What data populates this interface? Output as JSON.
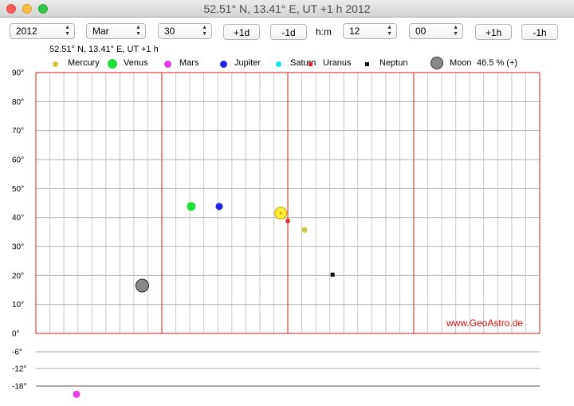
{
  "window": {
    "title": "52.51° N,  13.41° E,  UT +1 h 2012"
  },
  "controls": {
    "year": "2012",
    "month": "Mar",
    "day": "30",
    "plus_day": "+1d",
    "minus_day": "-1d",
    "hm_label": "h:m",
    "hour": "12",
    "minute": "00",
    "plus_hour": "+1h",
    "minus_hour": "-1h"
  },
  "location_label": "52.51° N,  13.41° E,  UT +1 h",
  "legend": [
    {
      "name": "Mercury",
      "color": "#cfc33a"
    },
    {
      "name": "Venus",
      "color": "#1ee036"
    },
    {
      "name": "Mars",
      "color": "#f03ce6"
    },
    {
      "name": "Jupiter",
      "color": "#2323e6"
    },
    {
      "name": "Saturn",
      "color": "#12e8e8"
    },
    {
      "name": "Uranus",
      "color": "#e02323"
    },
    {
      "name": "Neptun",
      "color": "#111111"
    },
    {
      "name": "Moon",
      "color": "#888888",
      "extra": "46.5 % (+)"
    }
  ],
  "credit": "www.GeoAstro.de",
  "chart_data": {
    "type": "scatter",
    "y_axis_unit": "altitude (degrees)",
    "ylim": [
      -18,
      90
    ],
    "y_ticks": [
      "90°",
      "80°",
      "70°",
      "60°",
      "50°",
      "40°",
      "30°",
      "20°",
      "10°",
      "0°",
      "-6°",
      "-12°",
      "-18°"
    ],
    "y_tick_values": [
      90,
      80,
      70,
      60,
      50,
      40,
      30,
      20,
      10,
      0,
      -6,
      -12,
      -18
    ],
    "azimuth_range": [
      0,
      360
    ],
    "major_verticals_azimuth": [
      90,
      180,
      270
    ],
    "points": [
      {
        "name": "Mercury",
        "x": 192,
        "y": 35.7,
        "color": "#cfc33a",
        "r": 3.5
      },
      {
        "name": "Venus",
        "x": 111,
        "y": 43.8,
        "color": "#1ee036",
        "r": 5.5
      },
      {
        "name": "Mars",
        "x": 29,
        "y": -20.8,
        "color": "#f03ce6",
        "r": 4.5
      },
      {
        "name": "Jupiter",
        "x": 131,
        "y": 43.8,
        "color": "#2323e6",
        "r": 4.5
      },
      {
        "name": "Uranus",
        "x": 180,
        "y": 38.8,
        "color": "#e02323",
        "r": 2.5
      },
      {
        "name": "Neptun",
        "x": 212,
        "y": 20.3,
        "color": "#111111",
        "r": 2.5
      },
      {
        "name": "Sun",
        "x": 175,
        "y": 41.5,
        "color": "#ffee33",
        "r": 7.5
      },
      {
        "name": "Moon",
        "x": 76,
        "y": 16.5,
        "color": "#888888",
        "r": 8
      }
    ]
  }
}
